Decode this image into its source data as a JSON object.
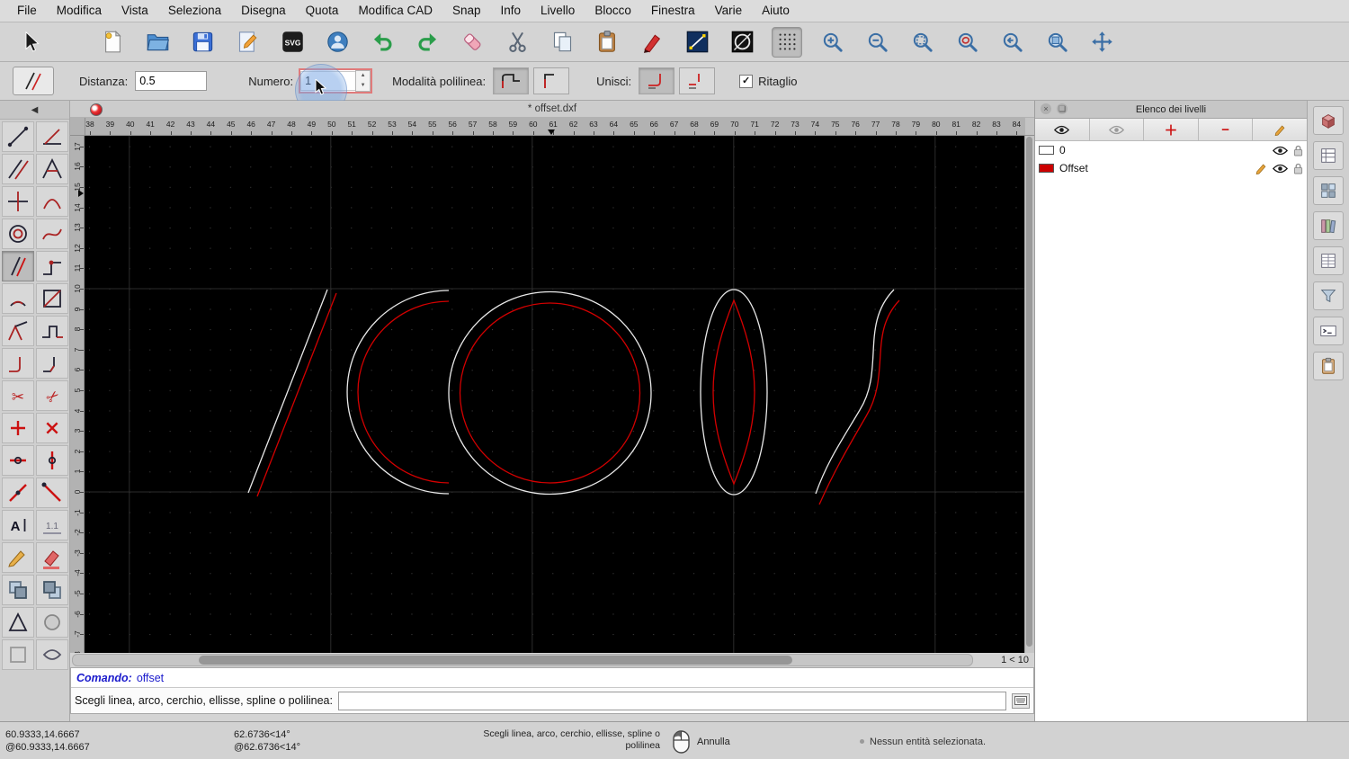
{
  "menu": {
    "items": [
      "File",
      "Modifica",
      "Vista",
      "Seleziona",
      "Disegna",
      "Quota",
      "Modifica CAD",
      "Snap",
      "Info",
      "Livello",
      "Blocco",
      "Finestra",
      "Varie",
      "Aiuto"
    ]
  },
  "toolbar": {
    "svg_label": "SVG",
    "buttons": [
      "select-cursor",
      "new-document",
      "open-file",
      "save-file",
      "edit-settings",
      "svg-export",
      "print-preview",
      "undo",
      "redo",
      "erase",
      "cut",
      "copy",
      "paste",
      "pen-attributes",
      "line-attributes",
      "circle-attributes",
      "grid-toggle",
      "zoom-in",
      "zoom-out",
      "zoom-auto",
      "zoom-redraw",
      "zoom-previous",
      "zoom-window",
      "zoom-pan"
    ]
  },
  "options": {
    "tool_icon": "offset-tool",
    "distance_label": "Distanza:",
    "distance_value": "0.5",
    "number_label": "Numero:",
    "number_value": "1",
    "polyline_mode_label": "Modalità polilinea:",
    "polyline_mode_buttons": [
      "polyline-mode-round",
      "polyline-mode-sharp"
    ],
    "join_label": "Unisci:",
    "join_buttons": [
      "join-round",
      "join-none"
    ],
    "clip_label": "Ritaglio",
    "clip_checked": true
  },
  "document": {
    "tab_title": "* offset.dxf",
    "h_ruler_start": 38,
    "h_ruler_end": 84,
    "v_ruler_start": -8,
    "v_ruler_end": 17,
    "grid_indicator": "1 < 10"
  },
  "canvas": {
    "background": "#000000",
    "original_color": "#e9e9e9",
    "offset_color": "#d40000",
    "entities": [
      "line",
      "arc",
      "circle",
      "ellipse",
      "spline"
    ],
    "offset_entities": [
      "line",
      "arc",
      "circle",
      "ellipse",
      "spline"
    ]
  },
  "palette": {
    "tools": [
      "line-two-points",
      "line-angle",
      "line-parallel",
      "line-triangle",
      "line-cross",
      "arc-three-points",
      "circle-concentric",
      "spline",
      "offset",
      "polyline",
      "arc-concentric",
      "rectangle-diagonal",
      "polygon-side",
      "polyline-segment",
      "fillet",
      "bevel",
      "trim",
      "trim-two",
      "divide-horizontal",
      "divide-vertical",
      "break-out",
      "break-vertical",
      "stretch-line",
      "stretch-diagonal",
      "text",
      "dimension-style",
      "edit-pencil",
      "highlight",
      "order-front",
      "order-back",
      "triangle-tool",
      "point-tool",
      "rect-tool",
      "lens-tool"
    ]
  },
  "layer_panel": {
    "title": "Elenco dei livelli",
    "buttons": [
      "show-all-layers",
      "show-active-layer",
      "add-layer",
      "remove-layer",
      "edit-layer"
    ],
    "layers": [
      {
        "name": "0",
        "color": "#ffffff",
        "current": false
      },
      {
        "name": "Offset",
        "color": "#cc0000",
        "current": true
      }
    ]
  },
  "right_strip": {
    "buttons": [
      "block-3d-view",
      "layer-panel-toggle",
      "block-panel-toggle",
      "library-browser-toggle",
      "property-editor-toggle",
      "selection-filter-toggle",
      "command-line-toggle",
      "clipboard-panel-toggle"
    ]
  },
  "command": {
    "prompt_label": "Comando:",
    "command_text": "offset",
    "instruction": "Scegli linea, arco, cerchio, ellisse, spline o polilinea:",
    "input_value": ""
  },
  "status": {
    "abs_coords": "60.9333,14.6667",
    "rel_coords": "@60.9333,14.6667",
    "abs_polar": "62.6736<14°",
    "rel_polar": "@62.6736<14°",
    "hint": "Scegli linea, arco, cerchio, ellisse, spline o polilinea",
    "mouse_left_action": "Annulla",
    "selection_status": "Nessun entità selezionata."
  }
}
